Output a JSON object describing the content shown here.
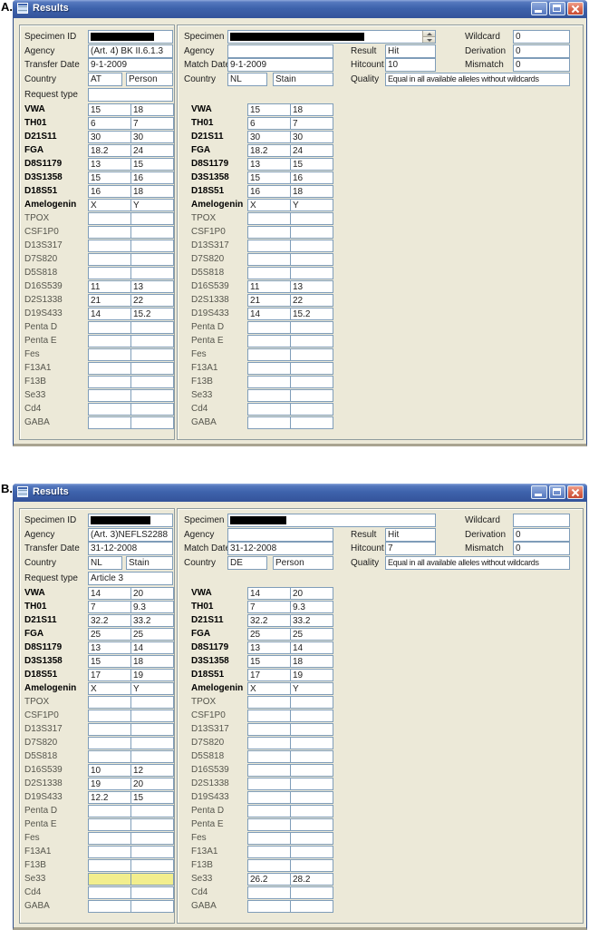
{
  "window_title": "Results",
  "colors": {
    "titlebar_blue": "#3E63AC",
    "close_button_red": "#D96C55",
    "window_background": "#ECE9D8",
    "field_border_blue": "#7F9DB9",
    "se33_highlight_yellow": "#F2EE8D"
  },
  "field_labels": {
    "specimen_id": "Specimen ID",
    "agency": "Agency",
    "transfer_date": "Transfer Date",
    "match_date": "Match Date",
    "country": "Country",
    "request_type": "Request type",
    "result": "Result",
    "hitcount": "Hitcount",
    "quality": "Quality",
    "wildcard": "Wildcard",
    "derivation": "Derivation",
    "mismatch": "Mismatch"
  },
  "loci_names": [
    "VWA",
    "TH01",
    "D21S11",
    "FGA",
    "D8S1179",
    "D3S1358",
    "D18S51",
    "Amelogenin",
    "TPOX",
    "CSF1P0",
    "D13S317",
    "D7S820",
    "D5S818",
    "D16S539",
    "D2S1338",
    "D19S433",
    "Penta D",
    "Penta E",
    "Fes",
    "F13A1",
    "F13B",
    "Se33",
    "Cd4",
    "GABA"
  ],
  "loci_bold_count": 8,
  "panels": [
    {
      "figure_label": "A.",
      "left": {
        "specimen_redacted": true,
        "specimen_redact_w": 70,
        "agency": "(Art. 4) BK II.6.1.3",
        "transfer_date": "9-1-2009",
        "country": "AT",
        "country_type": "Person",
        "request_type": ""
      },
      "right": {
        "specimen_redacted": true,
        "specimen_redact_w": 148,
        "has_spinner": true,
        "agency": "",
        "match_date": "9-1-2009",
        "country": "NL",
        "country_type": "Stain",
        "result": "Hit",
        "hitcount": "10",
        "quality": "Equal in all available alleles without wildcards",
        "wildcard": "0",
        "wildcard_caret": false,
        "derivation": "0",
        "mismatch": "0"
      },
      "left_values": [
        [
          "15",
          "18"
        ],
        [
          "6",
          "7"
        ],
        [
          "30",
          "30"
        ],
        [
          "18.2",
          "24"
        ],
        [
          "13",
          "15"
        ],
        [
          "15",
          "16"
        ],
        [
          "16",
          "18"
        ],
        [
          "X",
          "Y"
        ],
        [
          "",
          ""
        ],
        [
          "",
          ""
        ],
        [
          "",
          ""
        ],
        [
          "",
          ""
        ],
        [
          "",
          ""
        ],
        [
          "11",
          "13"
        ],
        [
          "21",
          "22"
        ],
        [
          "14",
          "15.2"
        ],
        [
          "",
          ""
        ],
        [
          "",
          ""
        ],
        [
          "",
          ""
        ],
        [
          "",
          ""
        ],
        [
          "",
          ""
        ],
        [
          "",
          ""
        ],
        [
          "",
          ""
        ],
        [
          "",
          ""
        ]
      ],
      "right_values": [
        [
          "15",
          "18"
        ],
        [
          "6",
          "7"
        ],
        [
          "30",
          "30"
        ],
        [
          "18.2",
          "24"
        ],
        [
          "13",
          "15"
        ],
        [
          "15",
          "16"
        ],
        [
          "16",
          "18"
        ],
        [
          "X",
          "Y"
        ],
        [
          "",
          ""
        ],
        [
          "",
          ""
        ],
        [
          "",
          ""
        ],
        [
          "",
          ""
        ],
        [
          "",
          ""
        ],
        [
          "11",
          "13"
        ],
        [
          "21",
          "22"
        ],
        [
          "14",
          "15.2"
        ],
        [
          "",
          ""
        ],
        [
          "",
          ""
        ],
        [
          "",
          ""
        ],
        [
          "",
          ""
        ],
        [
          "",
          ""
        ],
        [
          "",
          ""
        ],
        [
          "",
          ""
        ],
        [
          "",
          ""
        ]
      ],
      "left_highlight": [],
      "right_highlight": []
    },
    {
      "figure_label": "B.",
      "left": {
        "specimen_redacted": true,
        "specimen_redact_w": 66,
        "agency": "(Art. 3)NEFLS2288",
        "transfer_date": "31-12-2008",
        "country": "NL",
        "country_type": "Stain",
        "request_type": "Article 3"
      },
      "right": {
        "specimen_redacted": true,
        "specimen_redact_w": 62,
        "has_spinner": false,
        "agency": "",
        "match_date": "31-12-2008",
        "country": "DE",
        "country_type": "Person",
        "result": "Hit",
        "hitcount": "7",
        "quality": "Equal in all available alleles without wildcards",
        "wildcard": "",
        "wildcard_caret": true,
        "derivation": "0",
        "mismatch": "0"
      },
      "left_values": [
        [
          "14",
          "20"
        ],
        [
          "7",
          "9.3"
        ],
        [
          "32.2",
          "33.2"
        ],
        [
          "25",
          "25"
        ],
        [
          "13",
          "14"
        ],
        [
          "15",
          "18"
        ],
        [
          "17",
          "19"
        ],
        [
          "X",
          "Y"
        ],
        [
          "",
          ""
        ],
        [
          "",
          ""
        ],
        [
          "",
          ""
        ],
        [
          "",
          ""
        ],
        [
          "",
          ""
        ],
        [
          "10",
          "12"
        ],
        [
          "19",
          "20"
        ],
        [
          "12.2",
          "15"
        ],
        [
          "",
          ""
        ],
        [
          "",
          ""
        ],
        [
          "",
          ""
        ],
        [
          "",
          ""
        ],
        [
          "",
          ""
        ],
        [
          "",
          ""
        ],
        [
          "",
          ""
        ],
        [
          "",
          ""
        ]
      ],
      "right_values": [
        [
          "14",
          "20"
        ],
        [
          "7",
          "9.3"
        ],
        [
          "32.2",
          "33.2"
        ],
        [
          "25",
          "25"
        ],
        [
          "13",
          "14"
        ],
        [
          "15",
          "18"
        ],
        [
          "17",
          "19"
        ],
        [
          "X",
          "Y"
        ],
        [
          "",
          ""
        ],
        [
          "",
          ""
        ],
        [
          "",
          ""
        ],
        [
          "",
          ""
        ],
        [
          "",
          ""
        ],
        [
          "",
          ""
        ],
        [
          "",
          ""
        ],
        [
          "",
          ""
        ],
        [
          "",
          ""
        ],
        [
          "",
          ""
        ],
        [
          "",
          ""
        ],
        [
          "",
          ""
        ],
        [
          "",
          ""
        ],
        [
          "26.2",
          "28.2"
        ],
        [
          "",
          ""
        ],
        [
          "",
          ""
        ]
      ],
      "left_highlight": [
        21
      ],
      "right_highlight": []
    }
  ]
}
